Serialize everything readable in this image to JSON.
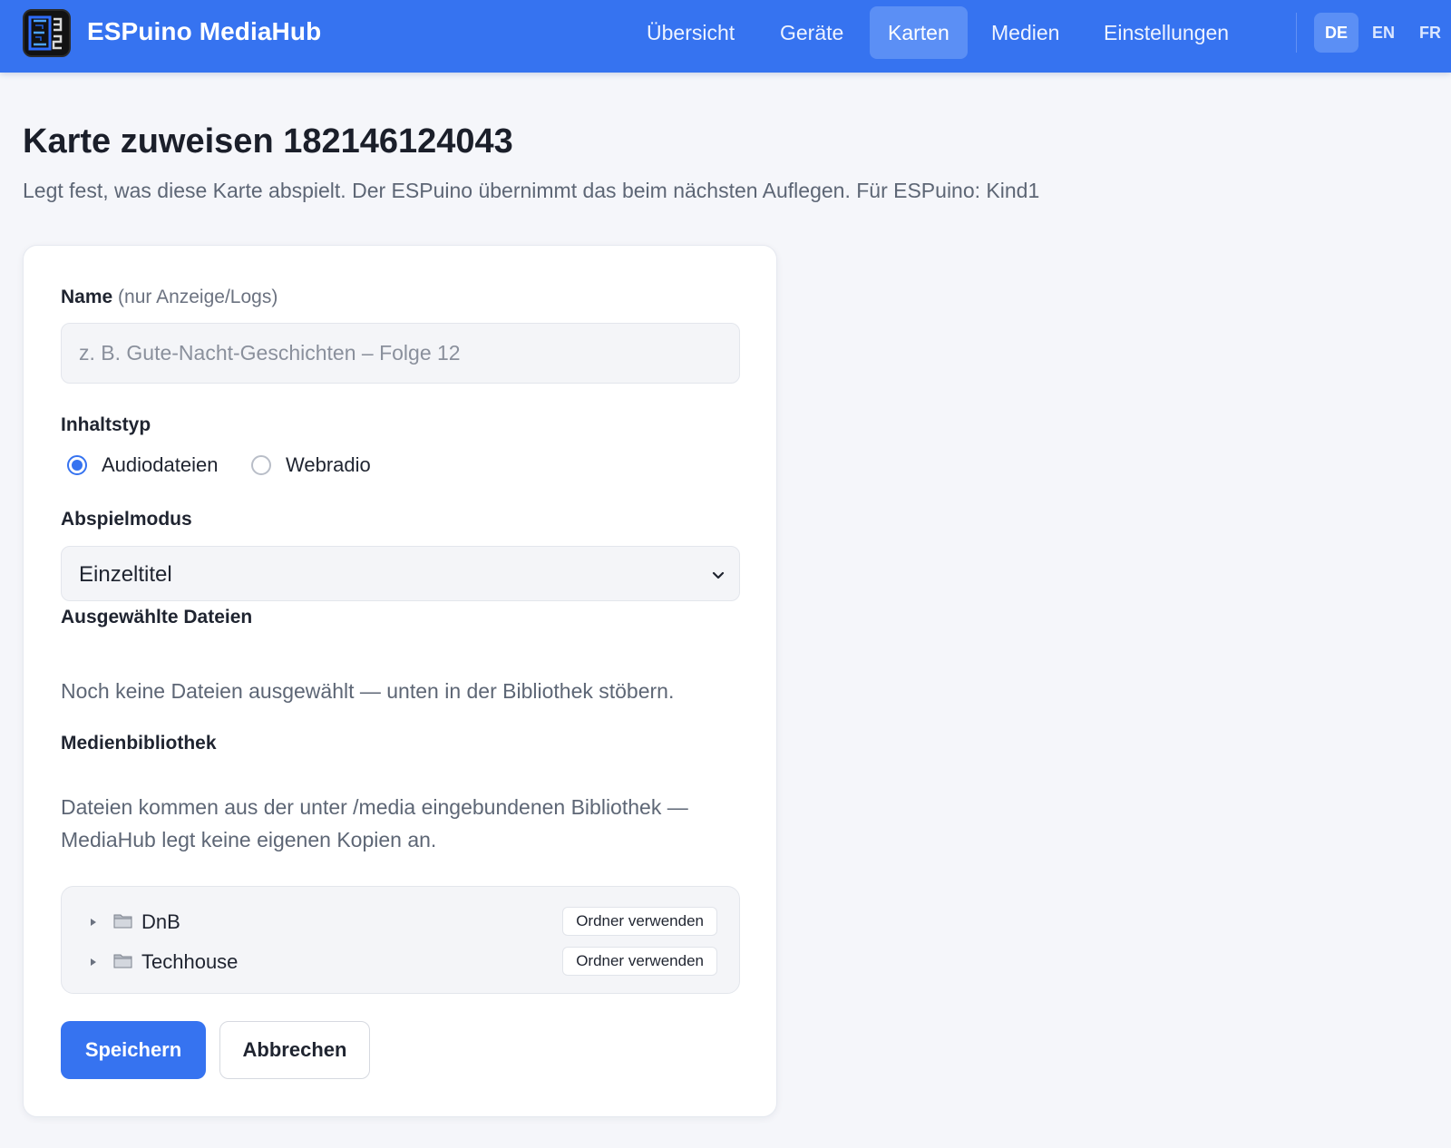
{
  "app": {
    "brand": "ESPuino MediaHub",
    "logo_icon": "e32-logo-icon"
  },
  "nav": {
    "items": [
      {
        "label": "Übersicht",
        "active": false
      },
      {
        "label": "Geräte",
        "active": false
      },
      {
        "label": "Karten",
        "active": true
      },
      {
        "label": "Medien",
        "active": false
      },
      {
        "label": "Einstellungen",
        "active": false
      }
    ],
    "languages": [
      {
        "label": "DE",
        "active": true
      },
      {
        "label": "EN",
        "active": false
      },
      {
        "label": "FR",
        "active": false
      }
    ]
  },
  "page": {
    "title": "Karte zuweisen 182146124043",
    "subtitle": "Legt fest, was diese Karte abspielt. Der ESPuino übernimmt das beim nächsten Auflegen. Für ESPuino: Kind1"
  },
  "form": {
    "name_label": "Name",
    "name_hint": "(nur Anzeige/Logs)",
    "name_value": "",
    "name_placeholder": "z. B. Gute-Nacht-Geschichten – Folge 12",
    "content_type_label": "Inhaltstyp",
    "content_types": [
      {
        "label": "Audiodateien",
        "checked": true
      },
      {
        "label": "Webradio",
        "checked": false
      }
    ],
    "playmode_label": "Abspielmodus",
    "playmode_value": "Einzeltitel",
    "selected_files_label": "Ausgewählte Dateien",
    "selected_files_empty": "Noch keine Dateien ausgewählt — unten in der Bibliothek stöbern.",
    "library_label": "Medienbibliothek",
    "library_note": "Dateien kommen aus der unter /media eingebundenen Bibliothek — MediaHub legt keine eigenen Kopien an.",
    "folders": [
      {
        "name": "DnB",
        "action": "Ordner verwenden"
      },
      {
        "name": "Techhouse",
        "action": "Ordner verwenden"
      }
    ],
    "save_label": "Speichern",
    "cancel_label": "Abbrechen"
  },
  "colors": {
    "accent": "#3673f0",
    "accent_active": "#5b8ff5",
    "background": "#f5f6fa"
  }
}
